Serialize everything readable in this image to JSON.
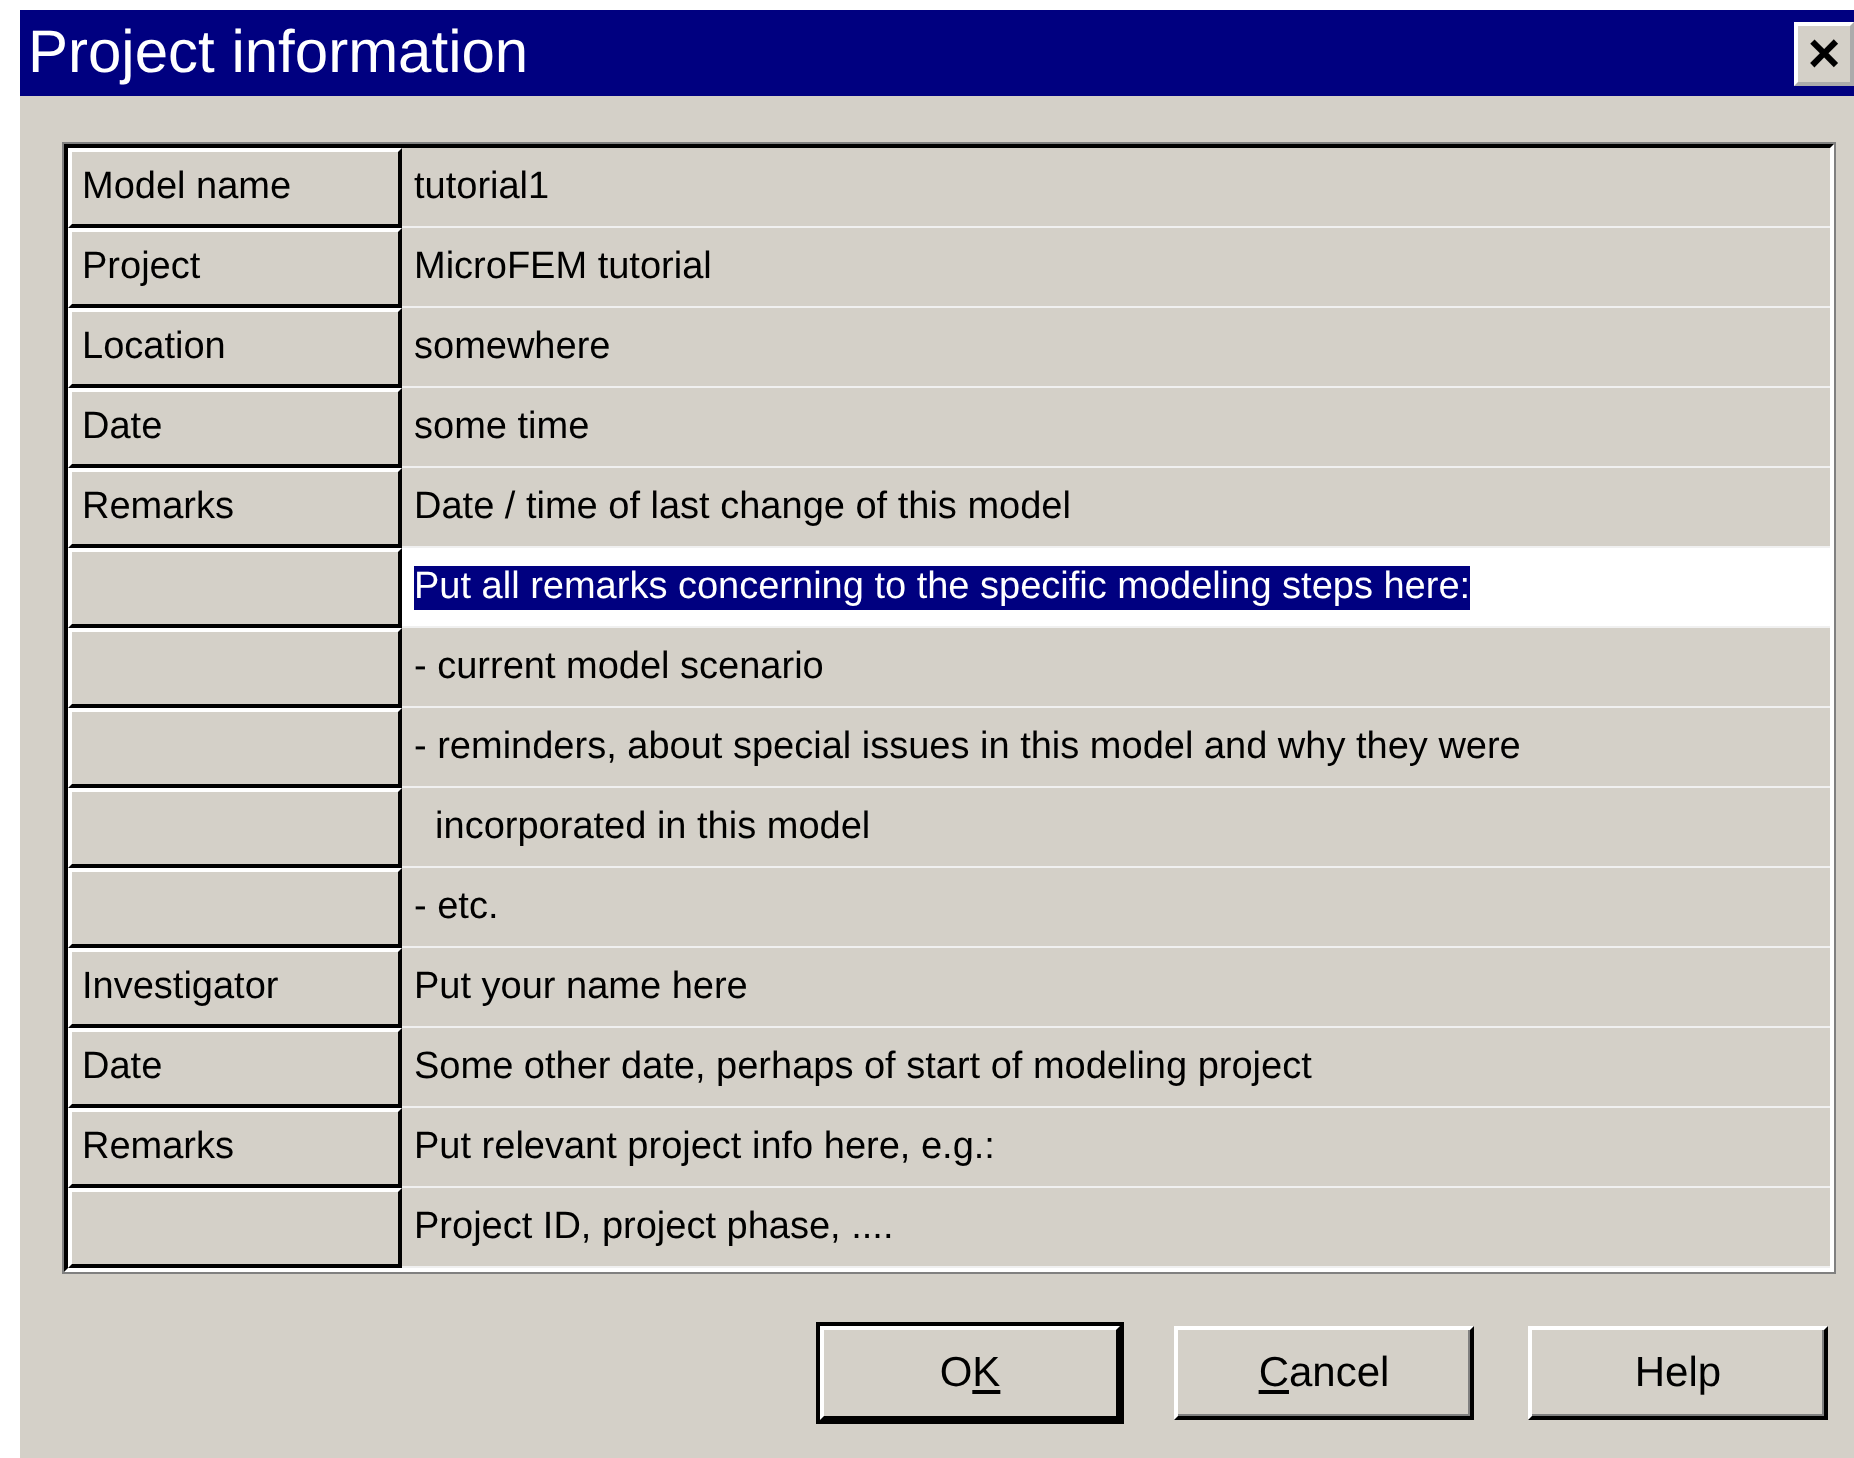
{
  "window": {
    "title": "Project information",
    "close": "×"
  },
  "rows": [
    {
      "label": "Model name",
      "value": "tutorial1",
      "selected": false
    },
    {
      "label": "Project",
      "value": "MicroFEM tutorial",
      "selected": false
    },
    {
      "label": "Location",
      "value": "somewhere",
      "selected": false
    },
    {
      "label": "Date",
      "value": "some time",
      "selected": false
    },
    {
      "label": "Remarks",
      "value": "Date / time of last change of this model",
      "selected": false
    },
    {
      "value": "Put all remarks concerning to the specific modeling steps here:",
      "selected": true
    },
    {
      "value": "- current model scenario",
      "selected": false
    },
    {
      "value": "- reminders, about special issues in this model and why they were",
      "selected": false
    },
    {
      "value": "  incorporated in this model",
      "selected": false
    },
    {
      "value": "- etc.",
      "selected": false
    },
    {
      "label": "Investigator",
      "value": "Put your name here",
      "selected": false
    },
    {
      "label": "Date",
      "value": "Some other date, perhaps of start of modeling project",
      "selected": false
    },
    {
      "label": "Remarks",
      "value": "Put relevant project info here, e.g.:",
      "selected": false
    },
    {
      "value": "Project ID, project phase, ....",
      "selected": false
    }
  ],
  "buttons": [
    {
      "before": "O",
      "accel": "K",
      "default": true
    },
    {
      "accel": "C",
      "after": "ancel",
      "default": false
    },
    {
      "before": "Help",
      "default": false
    }
  ]
}
